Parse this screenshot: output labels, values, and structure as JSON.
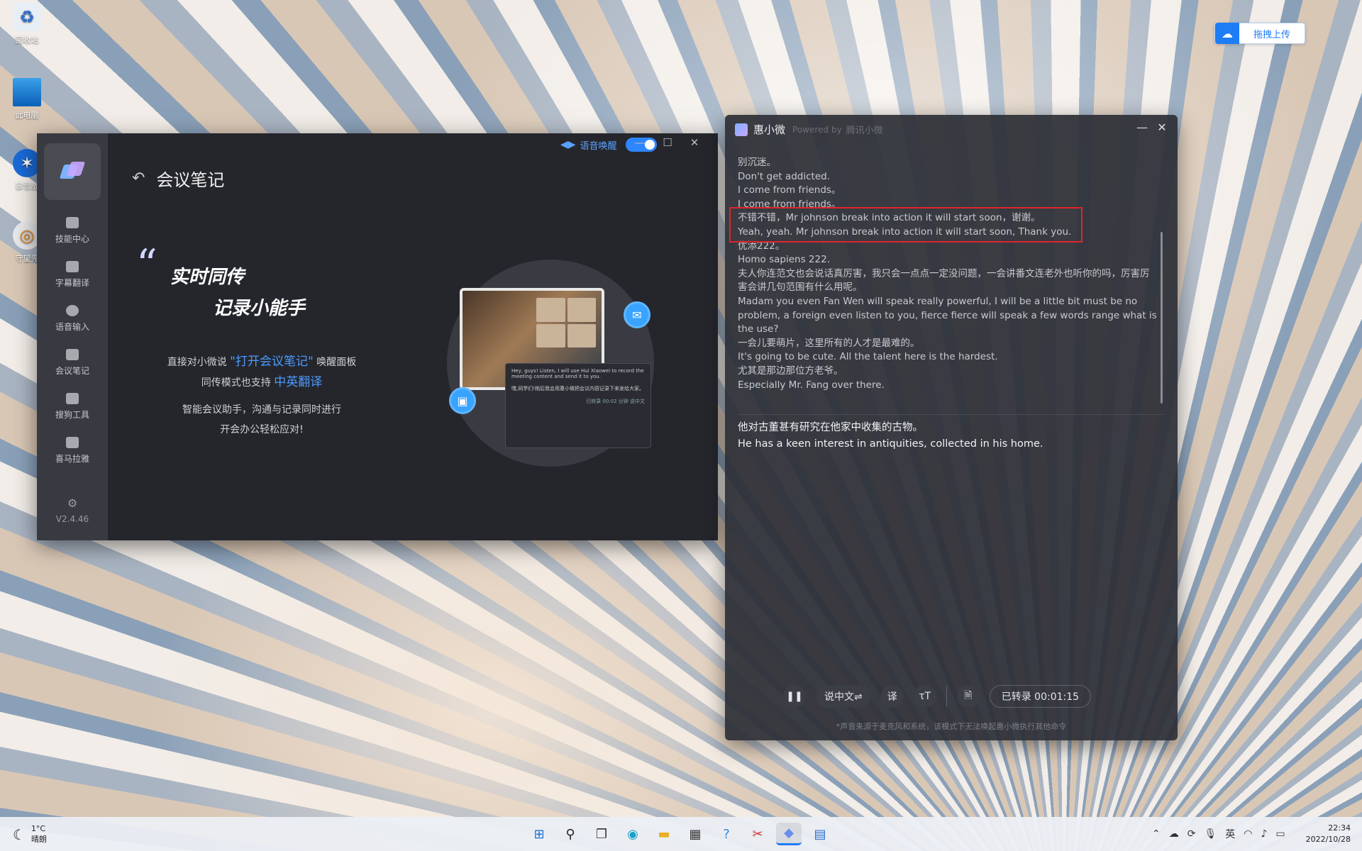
{
  "desktop": {
    "icons": [
      {
        "label": "回收站",
        "icon": "recycle-bin-icon"
      },
      {
        "label": "此电脑",
        "icon": "computer-icon"
      },
      {
        "label": "暴雪战",
        "icon": "battlenet-icon"
      },
      {
        "label": "守望先",
        "icon": "overwatch-icon"
      }
    ],
    "upload_label": "拖拽上传"
  },
  "app": {
    "page_title": "会议笔记",
    "voice_wake_label": "语音唤醒",
    "voice_wake_on": true,
    "sidebar": [
      {
        "label": "技能中心",
        "icon": "layers-icon"
      },
      {
        "label": "字幕翻译",
        "icon": "subtitle-icon"
      },
      {
        "label": "语音输入",
        "icon": "mic-wave-icon"
      },
      {
        "label": "会议笔记",
        "icon": "people-icon"
      },
      {
        "label": "搜狗工具",
        "icon": "sogou-icon"
      },
      {
        "label": "喜马拉雅",
        "icon": "ximalaya-icon"
      }
    ],
    "version": "V2.4.46",
    "hero": {
      "line1": "实时同传",
      "line2": "记录小能手",
      "desc1_pre": "直接对小微说 ",
      "desc1_hl": "\"打开会议笔记\"",
      "desc1_post": " 唤醒面板",
      "desc2_pre": "同传模式也支持 ",
      "desc2_hl": "中英翻译",
      "desc3": "智能会议助手，沟通与记录同时进行",
      "desc4": "开会办公轻松应对!"
    },
    "mini_panel": {
      "line1": "Hey, guys! Listen, I will use Hui Xiaowei to record the meeting content and send it to you.",
      "line2": "嘿,同学们!稍后我会用惠小微把会议内容记录下来发给大家。",
      "status": "已转录 00:02  分钟  说中文"
    }
  },
  "subtitle": {
    "title": "惠小微",
    "powered": "Powered by",
    "brand": "腾讯小微",
    "lines": [
      "别沉迷。",
      "Don't get addicted.",
      "I come from friends。",
      "I come from friends。",
      "不错不错，Mr johnson break into action it will start soon，谢谢。",
      "Yeah, yeah. Mr johnson break into action it will start soon, Thank you.",
      "优添222。",
      "Homo sapiens 222.",
      "夫人你连范文也会说话真厉害，我只会一点点一定没问题，一会讲番文连老外也听你的吗，厉害厉害会讲几句范围有什么用呢。",
      "Madam you even Fan Wen will speak really powerful, I will be a little bit must be no problem, a foreign even listen to you, fierce fierce will speak a few words range what is the use?",
      "一会儿要萌片，这里所有的人才是最难的。",
      "It's going to be cute. All the talent here is the hardest.",
      "尤其是那边那位方老爷。",
      "Especially Mr. Fang over there."
    ],
    "current_cn": "他对古董甚有研究在他家中收集的古物。",
    "current_en": "He has a keen interest in antiquities, collected in his home.",
    "lang_button": "说中文⇌",
    "translate_button": "译",
    "status": "已转录 00:01:15",
    "footnote": "*声音来源于麦克风和系统，该模式下无法唤起惠小微执行其他命令"
  },
  "taskbar": {
    "temp": "1°C",
    "weather": "晴朗",
    "ime": "英",
    "time": "22:34",
    "date": "2022/10/28"
  },
  "colors": {
    "accent": "#2e86ff",
    "highlight_box": "#e0242c"
  }
}
